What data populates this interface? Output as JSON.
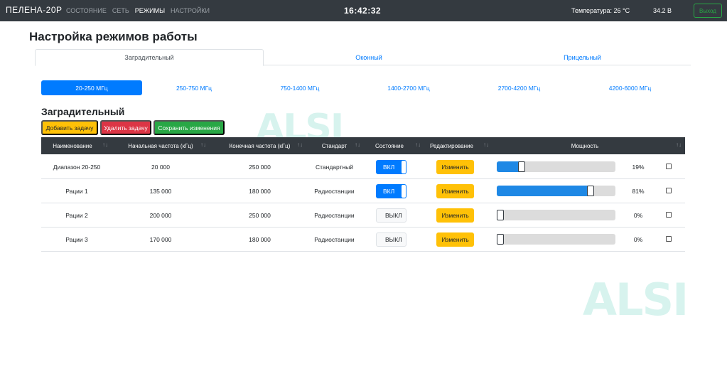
{
  "navbar": {
    "brand": "ПЕЛЕНА-20Р",
    "links": [
      "СОСТОЯНИЕ",
      "СЕТЬ",
      "РЕЖИМЫ",
      "НАСТРОЙКИ"
    ],
    "active_link": "РЕЖИМЫ",
    "clock": "16:42:32",
    "temperature": "Температура: 26 °C",
    "voltage": "34.2 В",
    "logout": "Выход"
  },
  "page": {
    "title": "Настройка режимов работы"
  },
  "tabs": [
    "Заградительный",
    "Оконный",
    "Прицельный"
  ],
  "freq_pills": [
    "20-250 МГц",
    "250-750 МГц",
    "750-1400 МГц",
    "1400-2700 МГц",
    "2700-4200 МГц",
    "4200-6000 МГц"
  ],
  "section": {
    "title": "Заградительный",
    "add_btn": "Добавить задачу",
    "delete_btn": "Удалить задачу",
    "save_btn": "Сохранить изменения"
  },
  "watermark": "ALSI",
  "table": {
    "headers": [
      "Наименование",
      "Начальная частота (кГц)",
      "Конечная частота (кГц)",
      "Стандарт",
      "Состояние",
      "Редактирование",
      "Мощность"
    ],
    "edit_label": "Изменить",
    "rows": [
      {
        "name": "Диапазон 20-250",
        "start": "20 000",
        "end": "250 000",
        "standard": "Стандартный",
        "state": "ВКЛ",
        "on": true,
        "power": 19,
        "power_label": "19%"
      },
      {
        "name": "Рации 1",
        "start": "135 000",
        "end": "180 000",
        "standard": "Радиостанции",
        "state": "ВКЛ",
        "on": true,
        "power": 81,
        "power_label": "81%"
      },
      {
        "name": "Рации 2",
        "start": "200 000",
        "end": "250 000",
        "standard": "Радиостанции",
        "state": "ВЫКЛ",
        "on": false,
        "power": 0,
        "power_label": "0%"
      },
      {
        "name": "Рации 3",
        "start": "170 000",
        "end": "180 000",
        "standard": "Радиостанции",
        "state": "ВЫКЛ",
        "on": false,
        "power": 0,
        "power_label": "0%"
      }
    ]
  }
}
